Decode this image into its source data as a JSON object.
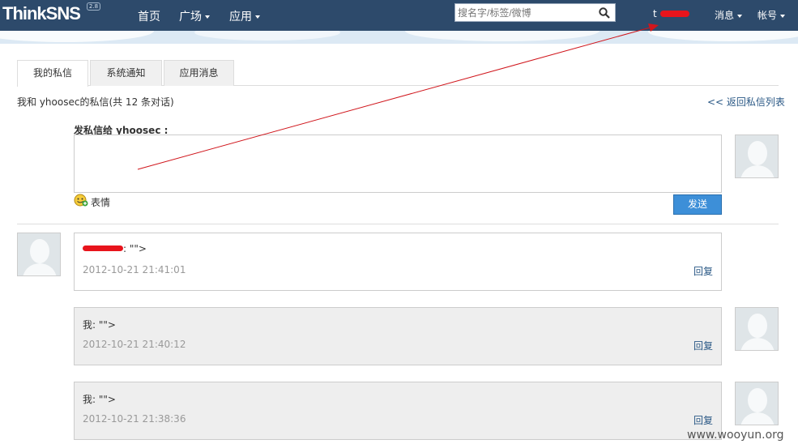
{
  "header": {
    "logo_text": "ThinkSNS",
    "logo_version": "2.8",
    "nav": [
      {
        "label": "首页",
        "has_caret": false
      },
      {
        "label": "广场",
        "has_caret": true
      },
      {
        "label": "应用",
        "has_caret": true
      }
    ],
    "search": {
      "placeholder": "搜名字/标签/微博",
      "value": ""
    },
    "user": {
      "name": "t"
    },
    "messages_label": "消息",
    "account_label": "帐号"
  },
  "tabs": [
    {
      "label": "我的私信",
      "active": true
    },
    {
      "label": "系统通知",
      "active": false
    },
    {
      "label": "应用消息",
      "active": false
    }
  ],
  "conversation": {
    "title": "我和 yhoosec的私信(共 12 条对话)",
    "back_link": "<< 返回私信列表"
  },
  "compose": {
    "label": "发私信给 yhoosec :",
    "value": "",
    "emoji_label": "表情",
    "send_label": "发送"
  },
  "messages": [
    {
      "direction": "in",
      "text": ": \"\">",
      "time": "2012-10-21 21:41:01",
      "reply_label": "回复"
    },
    {
      "direction": "out",
      "text": "我: \"\">",
      "time": "2012-10-21 21:40:12",
      "reply_label": "回复"
    },
    {
      "direction": "out",
      "text": "我: \"\">",
      "time": "2012-10-21 21:38:36",
      "reply_label": "回复"
    }
  ],
  "watermark": "www.wooyun.org",
  "colors": {
    "header_bg": "#2d4a6b",
    "link": "#2a5885",
    "send_button": "#3d8fd8",
    "annotation_red": "#e8141c"
  }
}
